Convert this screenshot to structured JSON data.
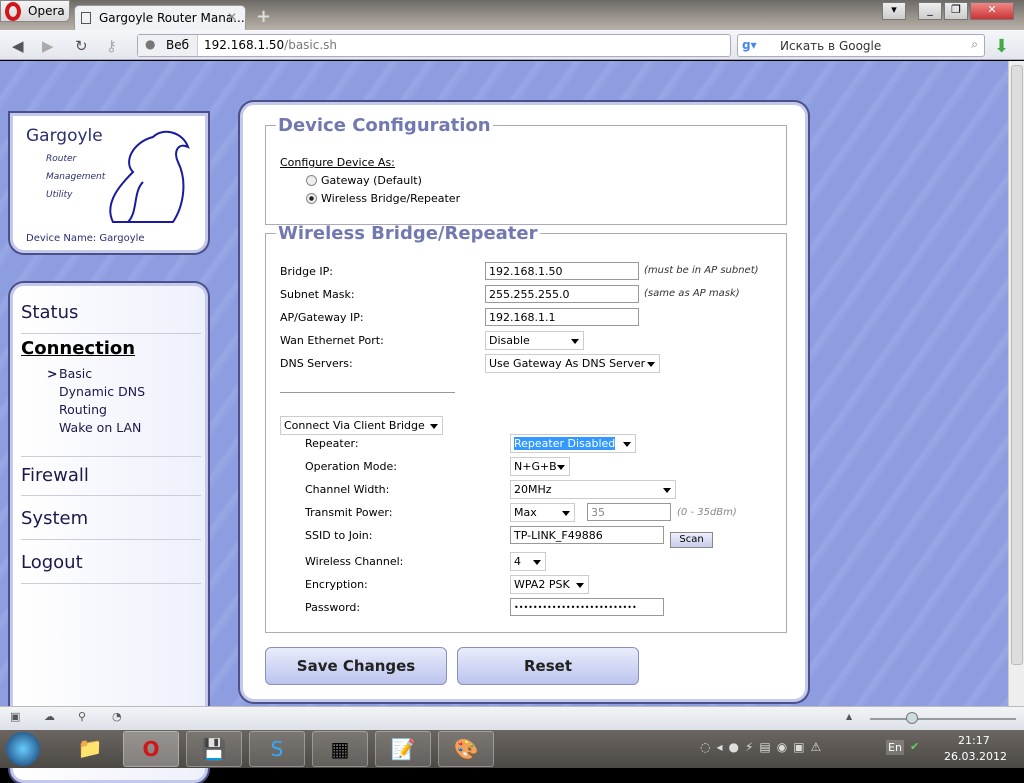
{
  "browser": {
    "menu_label": "Opera",
    "tab_title": "Gargoyle Router Mana...",
    "address_prefix": "Веб",
    "url_host": "192.168.1.50",
    "url_path": "/basic.sh",
    "search_placeholder": "Искать в Google"
  },
  "logo": {
    "title": "Gargoyle",
    "sub": [
      "Router",
      "Management",
      "Utility"
    ],
    "device_name": "Device Name: Gargoyle"
  },
  "nav": {
    "items": [
      "Status",
      "Connection",
      "Firewall",
      "System",
      "Logout"
    ],
    "active": "Connection",
    "sub": [
      "Basic",
      "Dynamic DNS",
      "Routing",
      "Wake on LAN"
    ],
    "active_sub_marker": ">"
  },
  "device_config": {
    "legend": "Device Configuration",
    "configure_label": "Configure Device As:",
    "options": [
      "Gateway (Default)",
      "Wireless Bridge/Repeater"
    ],
    "selected": 1
  },
  "bridge": {
    "legend": "Wireless Bridge/Repeater",
    "bridge_ip_label": "Bridge IP:",
    "bridge_ip": "192.168.1.50",
    "bridge_ip_hint": "(must be in AP subnet)",
    "mask_label": "Subnet Mask:",
    "mask": "255.255.255.0",
    "mask_hint": "(same as AP mask)",
    "gateway_label": "AP/Gateway IP:",
    "gateway": "192.168.1.1",
    "wan_label": "Wan Ethernet Port:",
    "wan": "Disable",
    "dns_label": "DNS Servers:",
    "dns": "Use Gateway As DNS Server",
    "connect_mode": "Connect Via Client Bridge",
    "repeater_label": "Repeater:",
    "repeater": "Repeater Disabled",
    "opmode_label": "Operation Mode:",
    "opmode": "N+G+B",
    "chwidth_label": "Channel Width:",
    "chwidth": "20MHz",
    "txpower_label": "Transmit Power:",
    "txpower": "Max",
    "txpower_value": "35",
    "txpower_hint": "(0 - 35dBm)",
    "ssid_label": "SSID to Join:",
    "ssid": "TP-LINK_F49886",
    "scan": "Scan",
    "channel_label": "Wireless Channel:",
    "channel": "4",
    "enc_label": "Encryption:",
    "enc": "WPA2 PSK",
    "pass_label": "Password:",
    "pass": "••••••••••••••••••••••••••"
  },
  "actions": {
    "save": "Save Changes",
    "reset": "Reset"
  },
  "taskbar": {
    "lang": "En",
    "time": "21:17",
    "date": "26.03.2012"
  },
  "colors": {
    "page_bg": "#8d9de0",
    "legend": "#7278b0",
    "selection": "#3399ff"
  }
}
